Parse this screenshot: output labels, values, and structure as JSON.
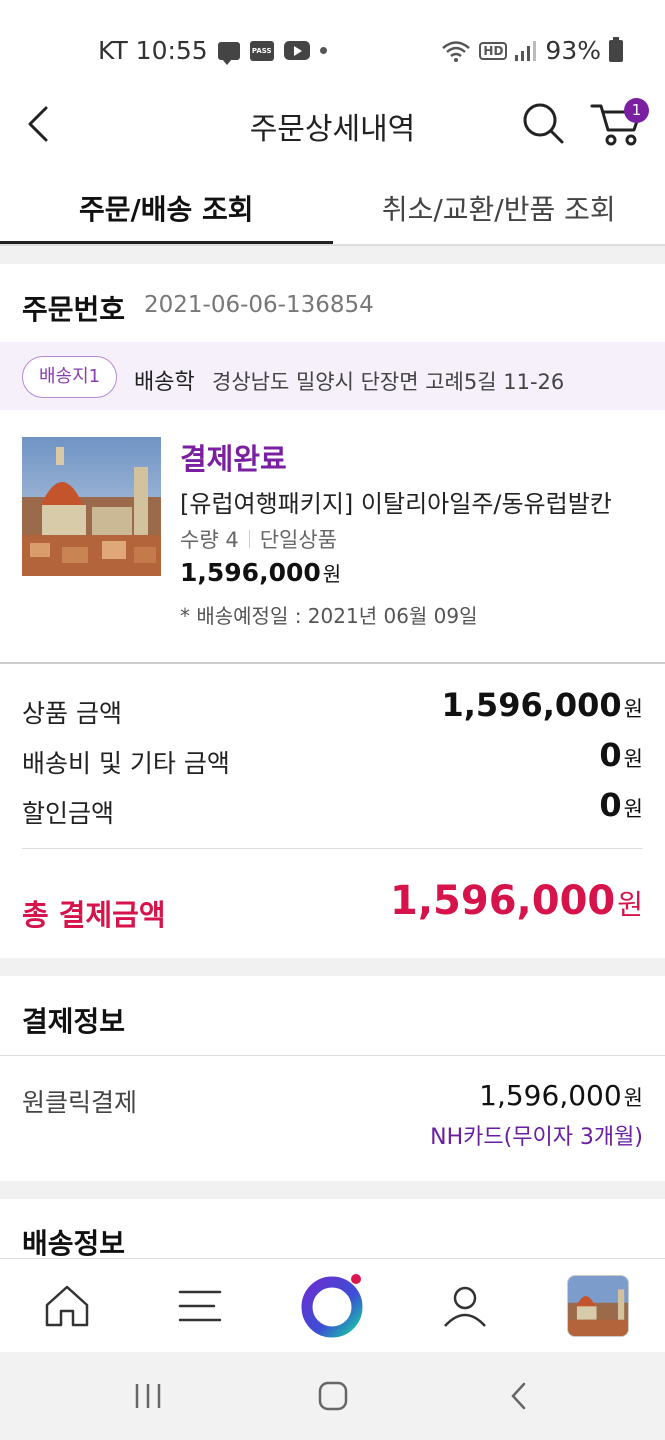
{
  "status_bar": {
    "carrier_time": "KT 10:55",
    "pass_label": "PASS",
    "hd_label": "HD",
    "battery": "93%"
  },
  "header": {
    "title": "주문상세내역",
    "cart_count": "1"
  },
  "tabs": [
    {
      "label": "주문/배송 조회",
      "active": true
    },
    {
      "label": "취소/교환/반품 조회",
      "active": false
    }
  ],
  "order": {
    "number_label": "주문번호",
    "number_value": "2021-06-06-136854"
  },
  "address": {
    "chip": "배송지1",
    "recipient": "배송학",
    "text": "경상남도 밀양시 단장면 고례5길 11-26"
  },
  "product": {
    "status": "결제완료",
    "name": "[유럽여행패키지] 이탈리아일주/동유럽발칸",
    "quantity": "수량 4",
    "option": "단일상품",
    "price": "1,596,000",
    "price_unit": "원",
    "eta": "* 배송예정일 : 2021년 06월 09일"
  },
  "amounts": {
    "product_label": "상품 금액",
    "product_value": "1,596,000",
    "shipping_label": "배송비 및 기타 금액",
    "shipping_value": "0",
    "discount_label": "할인금액",
    "discount_value": "0",
    "total_label": "총 결제금액",
    "total_value": "1,596,000",
    "unit": "원"
  },
  "payment": {
    "section_title": "결제정보",
    "method": "원클릭결제",
    "amount": "1,596,000",
    "unit": "원",
    "card": "NH카드(무이자 3개월)"
  },
  "shipping": {
    "section_title": "배송정보"
  },
  "colors": {
    "accent": "#7a1fa2",
    "total": "#d6134a",
    "address_band": "#f6f0fb"
  }
}
